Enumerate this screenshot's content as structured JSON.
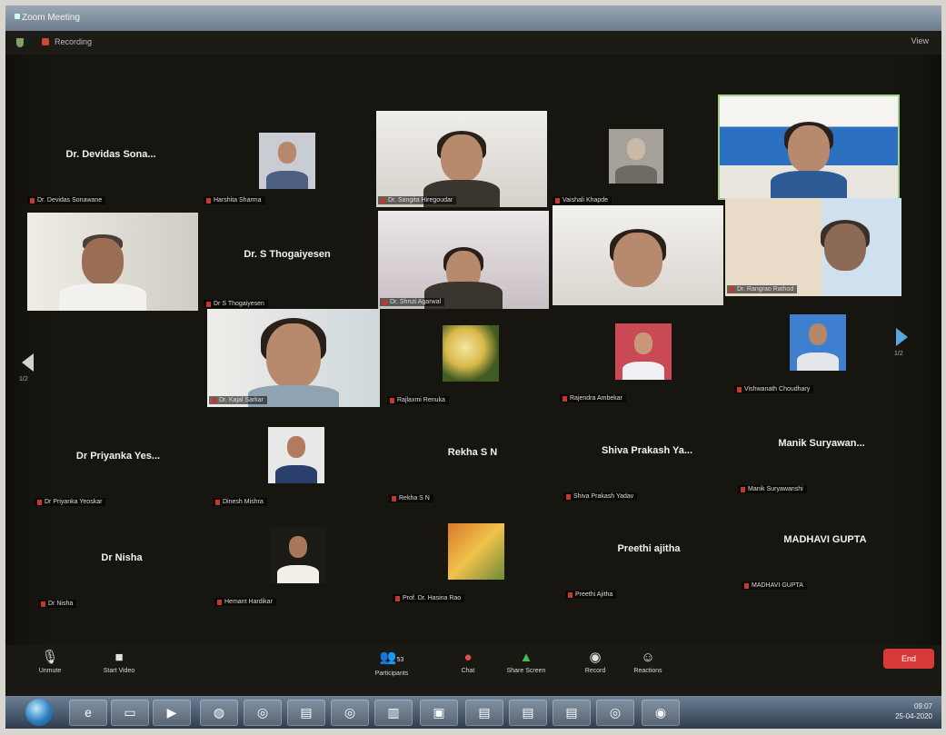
{
  "window": {
    "title": "Zoom Meeting",
    "top_left_label": "Recording",
    "top_right_label": "View"
  },
  "nav": {
    "left_page": "1/2",
    "right_page": "1/2"
  },
  "participants": [
    {
      "type": "name",
      "big": "Dr. Devidas Sona...",
      "label": "Dr. Devidas Sonawane"
    },
    {
      "type": "photo",
      "label": "Harshita Sharma"
    },
    {
      "type": "video",
      "label": "Dr. Sangita Hiregoudar"
    },
    {
      "type": "photo",
      "label": "Vaishali Khapde"
    },
    {
      "type": "video",
      "label": ""
    },
    {
      "type": "video",
      "label": ""
    },
    {
      "type": "name",
      "big": "Dr. S Thogaiyesen",
      "label": "Dr S Thogaiyesen"
    },
    {
      "type": "video",
      "label": "Dr. Shruti Agarwal"
    },
    {
      "type": "video",
      "label": ""
    },
    {
      "type": "video",
      "label": "Dr. Rangrao Rathod"
    },
    {
      "type": "video",
      "label": "Dr. Kajal Sarkar"
    },
    {
      "type": "photo",
      "label": "Rajlaxmi Renuka"
    },
    {
      "type": "photo",
      "label": "Rajendra Ambekar"
    },
    {
      "type": "photo",
      "label": "Vishwanath Choudhary"
    },
    {
      "type": "name",
      "big": "Dr Priyanka Yes...",
      "label": "Dr Priyanka Yeoskar"
    },
    {
      "type": "photo",
      "label": "Dinesh Mishra"
    },
    {
      "type": "name",
      "big": "Rekha S N",
      "label": "Rekha S N"
    },
    {
      "type": "name",
      "big": "Shiva Prakash Ya...",
      "label": "Shiva Prakash Yadav"
    },
    {
      "type": "name",
      "big": "Manik Suryawan...",
      "label": "Manik Suryawanshi"
    },
    {
      "type": "name",
      "big": "Dr Nisha",
      "label": "Dr Nisha"
    },
    {
      "type": "photo",
      "label": "Hemant Hardikar"
    },
    {
      "type": "photo",
      "label": "Prof. Dr. Hasina Rao"
    },
    {
      "type": "name",
      "big": "Preethi ajitha",
      "label": "Preethi Ajitha"
    },
    {
      "type": "name",
      "big": "MADHAVI GUPTA",
      "label": "MADHAVI GUPTA"
    }
  ],
  "toolbar": {
    "mute": "Unmute",
    "video": "Start Video",
    "participants": "Participants",
    "participants_count": "53",
    "chat": "Chat",
    "share": "Share Screen",
    "record": "Record",
    "reactions": "Reactions",
    "end": "End"
  },
  "tray": {
    "time": "09:07",
    "date": "25-04-2020"
  }
}
